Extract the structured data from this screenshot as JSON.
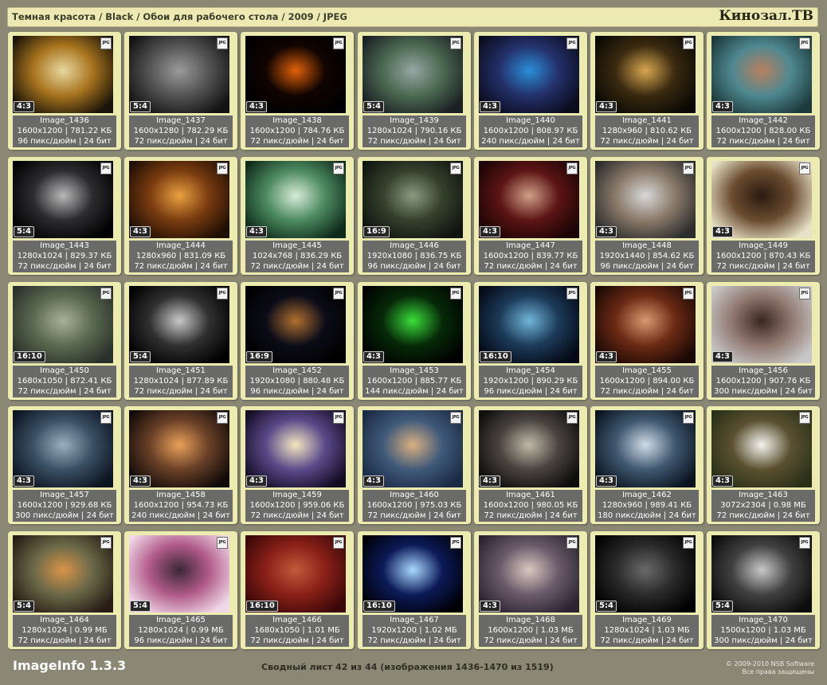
{
  "header": {
    "breadcrumb": "Темная красота / Black / Обои для рабочего стола / 2009 / JPEG",
    "site_logo": "Кинозал.ТВ"
  },
  "footer": {
    "app_title": "ImageInfo 1.3.3",
    "page_summary": "Сводный лист 42 из 44 (изображения 1436-1470 из 1519)",
    "copyright_line1": "© 2009-2010 NSB Software",
    "copyright_line2": "Все права защищены"
  },
  "badge_label": "JPG",
  "images": [
    {
      "name": "Image_1436",
      "size": "1600x1200 | 781.22 КБ",
      "meta": "96 пикс/дюйм | 24 бит",
      "aspect": "4:3",
      "colors": [
        "#1a1408",
        "#a8741e",
        "#e8d7a0"
      ]
    },
    {
      "name": "Image_1437",
      "size": "1600x1280 | 782.29 КБ",
      "meta": "72 пикс/дюйм | 24 бит",
      "aspect": "5:4",
      "colors": [
        "#121212",
        "#545454",
        "#9a9a9a"
      ]
    },
    {
      "name": "Image_1438",
      "size": "1600x1200 | 784.76 КБ",
      "meta": "72 пикс/дюйм | 24 бит",
      "aspect": "4:3",
      "colors": [
        "#000000",
        "#100400",
        "#e0600a"
      ]
    },
    {
      "name": "Image_1439",
      "size": "1280x1024 | 790.16 КБ",
      "meta": "72 пикс/дюйм | 24 бит",
      "aspect": "5:4",
      "colors": [
        "#1a2024",
        "#4d6a52",
        "#96a6a4"
      ]
    },
    {
      "name": "Image_1440",
      "size": "1600x1200 | 808.97 КБ",
      "meta": "240 пикс/дюйм | 24 бит",
      "aspect": "4:3",
      "colors": [
        "#0a0c1c",
        "#24306a",
        "#2a8ed8"
      ]
    },
    {
      "name": "Image_1441",
      "size": "1280x960 | 810.62 КБ",
      "meta": "72 пикс/дюйм | 24 бит",
      "aspect": "4:3",
      "colors": [
        "#0a0804",
        "#3a2a10",
        "#d8a850"
      ]
    },
    {
      "name": "Image_1442",
      "size": "1600x1200 | 828.00 КБ",
      "meta": "72 пикс/дюйм | 24 бит",
      "aspect": "4:3",
      "colors": [
        "#1c3a3c",
        "#4f8890",
        "#b88060"
      ]
    },
    {
      "name": "Image_1443",
      "size": "1280x1024 | 829.37 КБ",
      "meta": "72 пикс/дюйм | 24 бит",
      "aspect": "5:4",
      "colors": [
        "#000000",
        "#2c2c30",
        "#b8b8b8"
      ]
    },
    {
      "name": "Image_1444",
      "size": "1280x960 | 831.09 КБ",
      "meta": "72 пикс/дюйм | 24 бит",
      "aspect": "4:3",
      "colors": [
        "#1e0e04",
        "#7a3c10",
        "#e8a040"
      ]
    },
    {
      "name": "Image_1445",
      "size": "1024x768 | 836.29 КБ",
      "meta": "72 пикс/дюйм | 24 бит",
      "aspect": "4:3",
      "colors": [
        "#0e2a1a",
        "#4c8a60",
        "#d8ecd8"
      ]
    },
    {
      "name": "Image_1446",
      "size": "1920x1080 | 836.75 КБ",
      "meta": "96 пикс/дюйм | 24 бит",
      "aspect": "16:9",
      "colors": [
        "#101410",
        "#34402c",
        "#8a9a80"
      ]
    },
    {
      "name": "Image_1447",
      "size": "1600x1200 | 839.77 КБ",
      "meta": "72 пикс/дюйм | 24 бит",
      "aspect": "4:3",
      "colors": [
        "#1a0404",
        "#5c1414",
        "#d0a088"
      ]
    },
    {
      "name": "Image_1448",
      "size": "1920x1440 | 854.62 КБ",
      "meta": "96 пикс/дюйм | 24 бит",
      "aspect": "4:3",
      "colors": [
        "#2c2c2c",
        "#8a7a6a",
        "#d8d8d8"
      ]
    },
    {
      "name": "Image_1449",
      "size": "1600x1200 | 870.43 КБ",
      "meta": "72 пикс/дюйм | 24 бит",
      "aspect": "4:3",
      "colors": [
        "#e8e2c8",
        "#6a4c30",
        "#2a1a10"
      ]
    },
    {
      "name": "Image_1450",
      "size": "1680x1050 | 872.41 КБ",
      "meta": "72 пикс/дюйм | 24 бит",
      "aspect": "16:10",
      "colors": [
        "#2a302a",
        "#5a6a50",
        "#a8b098"
      ]
    },
    {
      "name": "Image_1451",
      "size": "1280x1024 | 877.89 КБ",
      "meta": "72 пикс/дюйм | 24 бит",
      "aspect": "5:4",
      "colors": [
        "#000000",
        "#303030",
        "#c8c8c8"
      ]
    },
    {
      "name": "Image_1452",
      "size": "1920x1080 | 880.48 КБ",
      "meta": "96 пикс/дюйм | 24 бит",
      "aspect": "16:9",
      "colors": [
        "#000000",
        "#0c0c18",
        "#b07030"
      ]
    },
    {
      "name": "Image_1453",
      "size": "1600x1200 | 885.77 КБ",
      "meta": "144 пикс/дюйм | 24 бит",
      "aspect": "4:3",
      "colors": [
        "#000000",
        "#062a08",
        "#3ade3a"
      ]
    },
    {
      "name": "Image_1454",
      "size": "1920x1200 | 890.29 КБ",
      "meta": "96 пикс/дюйм | 24 бит",
      "aspect": "16:10",
      "colors": [
        "#040814",
        "#1c3a58",
        "#70b4d8"
      ]
    },
    {
      "name": "Image_1455",
      "size": "1600x1200 | 894.00 КБ",
      "meta": "72 пикс/дюйм | 24 бит",
      "aspect": "4:3",
      "colors": [
        "#1a0804",
        "#6c2a14",
        "#d89870"
      ]
    },
    {
      "name": "Image_1456",
      "size": "1600x1200 | 907.76 КБ",
      "meta": "300 пикс/дюйм | 24 бит",
      "aspect": "4:3",
      "colors": [
        "#c8c8c8",
        "#907870",
        "#3a2620"
      ]
    },
    {
      "name": "Image_1457",
      "size": "1600x1200 | 929.68 КБ",
      "meta": "300 пикс/дюйм | 24 бит",
      "aspect": "4:3",
      "colors": [
        "#0c1420",
        "#3a5064",
        "#9ab0c0"
      ]
    },
    {
      "name": "Image_1458",
      "size": "1600x1200 | 954.73 КБ",
      "meta": "240 пикс/дюйм | 24 бит",
      "aspect": "4:3",
      "colors": [
        "#100a08",
        "#6a4028",
        "#e8a058"
      ]
    },
    {
      "name": "Image_1459",
      "size": "1600x1200 | 959.06 КБ",
      "meta": "72 пикс/дюйм | 24 бит",
      "aspect": "4:3",
      "colors": [
        "#140c24",
        "#5a4a8a",
        "#f4e8c0"
      ]
    },
    {
      "name": "Image_1460",
      "size": "1600x1200 | 975.03 КБ",
      "meta": "72 пикс/дюйм | 24 бит",
      "aspect": "4:3",
      "colors": [
        "#1a2a44",
        "#405a7a",
        "#d8b080"
      ]
    },
    {
      "name": "Image_1461",
      "size": "1600x1200 | 980.05 КБ",
      "meta": "72 пикс/дюйм | 24 бит",
      "aspect": "4:3",
      "colors": [
        "#0c0c0c",
        "#4a4440",
        "#c0b8a8"
      ]
    },
    {
      "name": "Image_1462",
      "size": "1280x960 | 989.41 КБ",
      "meta": "180 пикс/дюйм | 24 бит",
      "aspect": "4:3",
      "colors": [
        "#0a1420",
        "#405870",
        "#d0dce8"
      ]
    },
    {
      "name": "Image_1463",
      "size": "3072x2304 | 0.98 МБ",
      "meta": "72 пикс/дюйм | 24 бит",
      "aspect": "4:3",
      "colors": [
        "#2a3018",
        "#5a5030",
        "#f4f4f0"
      ]
    },
    {
      "name": "Image_1464",
      "size": "1280x1024 | 0.99 МБ",
      "meta": "72 пикс/дюйм | 24 бит",
      "aspect": "5:4",
      "colors": [
        "#281c14",
        "#6a6848",
        "#d89448"
      ]
    },
    {
      "name": "Image_1465",
      "size": "1280x1024 | 0.99 МБ",
      "meta": "96 пикс/дюйм | 24 бит",
      "aspect": "5:4",
      "colors": [
        "#f0d8e8",
        "#b05a88",
        "#3a2838"
      ]
    },
    {
      "name": "Image_1466",
      "size": "1680x1050 | 1.01 МБ",
      "meta": "72 пикс/дюйм | 24 бит",
      "aspect": "16:10",
      "colors": [
        "#3a0808",
        "#8a2018",
        "#c05a3a"
      ]
    },
    {
      "name": "Image_1467",
      "size": "1920x1200 | 1.02 МБ",
      "meta": "72 пикс/дюйм | 24 бит",
      "aspect": "16:10",
      "colors": [
        "#000004",
        "#0c1a58",
        "#a8d8ff"
      ]
    },
    {
      "name": "Image_1468",
      "size": "1600x1200 | 1.03 МБ",
      "meta": "72 пикс/дюйм | 24 бит",
      "aspect": "4:3",
      "colors": [
        "#2a2430",
        "#6a5a6a",
        "#d8c8c0"
      ]
    },
    {
      "name": "Image_1469",
      "size": "1280x1024 | 1.03 МБ",
      "meta": "72 пикс/дюйм | 24 бит",
      "aspect": "5:4",
      "colors": [
        "#000000",
        "#2a2a2a",
        "#6a6a6a"
      ]
    },
    {
      "name": "Image_1470",
      "size": "1500x1200 | 1.03 МБ",
      "meta": "300 пикс/дюйм | 24 бит",
      "aspect": "5:4",
      "colors": [
        "#0c0c0c",
        "#404040",
        "#c8c8c8"
      ]
    }
  ]
}
